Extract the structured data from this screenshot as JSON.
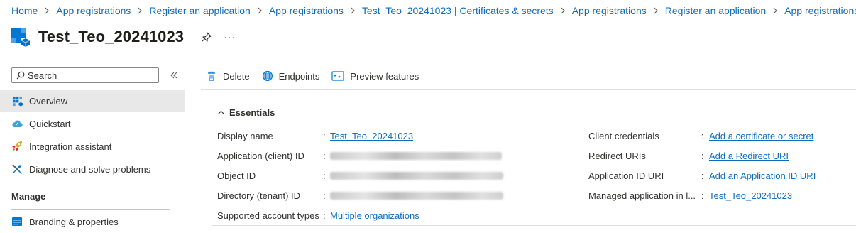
{
  "breadcrumb": [
    "Home",
    "App registrations",
    "Register an application",
    "App registrations",
    "Test_Teo_20241023 | Certificates & secrets",
    "App registrations",
    "Register an application",
    "App registrations"
  ],
  "header": {
    "title": "Test_Teo_20241023",
    "more": "···"
  },
  "sidebar": {
    "search_placeholder": "Search",
    "items": [
      {
        "label": "Overview",
        "icon": "overview-icon",
        "active": true
      },
      {
        "label": "Quickstart",
        "icon": "cloud-icon"
      },
      {
        "label": "Integration assistant",
        "icon": "rocket-icon"
      },
      {
        "label": "Diagnose and solve problems",
        "icon": "wrench-icon"
      }
    ],
    "section": "Manage",
    "manage_items": [
      {
        "label": "Branding & properties",
        "icon": "branding-icon"
      }
    ]
  },
  "toolbar": {
    "delete": "Delete",
    "endpoints": "Endpoints",
    "preview": "Preview features"
  },
  "essentials": {
    "title": "Essentials",
    "left": [
      {
        "label": "Display name",
        "value": "Test_Teo_20241023",
        "type": "link"
      },
      {
        "label": "Application (client) ID",
        "value": "",
        "type": "redacted"
      },
      {
        "label": "Object ID",
        "value": "",
        "type": "redacted"
      },
      {
        "label": "Directory (tenant) ID",
        "value": "",
        "type": "redacted"
      },
      {
        "label": "Supported account types",
        "value": "Multiple organizations",
        "type": "link"
      }
    ],
    "right": [
      {
        "label": "Client credentials",
        "value": "Add a certificate or secret",
        "type": "link"
      },
      {
        "label": "Redirect URIs",
        "value": "Add a Redirect URI",
        "type": "link"
      },
      {
        "label": "Application ID URI",
        "value": "Add an Application ID URI",
        "type": "link"
      },
      {
        "label": "Managed application in l...",
        "value": "Test_Teo_20241023",
        "type": "link"
      }
    ],
    "separator": ":"
  },
  "colors": {
    "link": "#0f6cbd",
    "text": "#323130",
    "active_bg": "#e8e8e8"
  }
}
